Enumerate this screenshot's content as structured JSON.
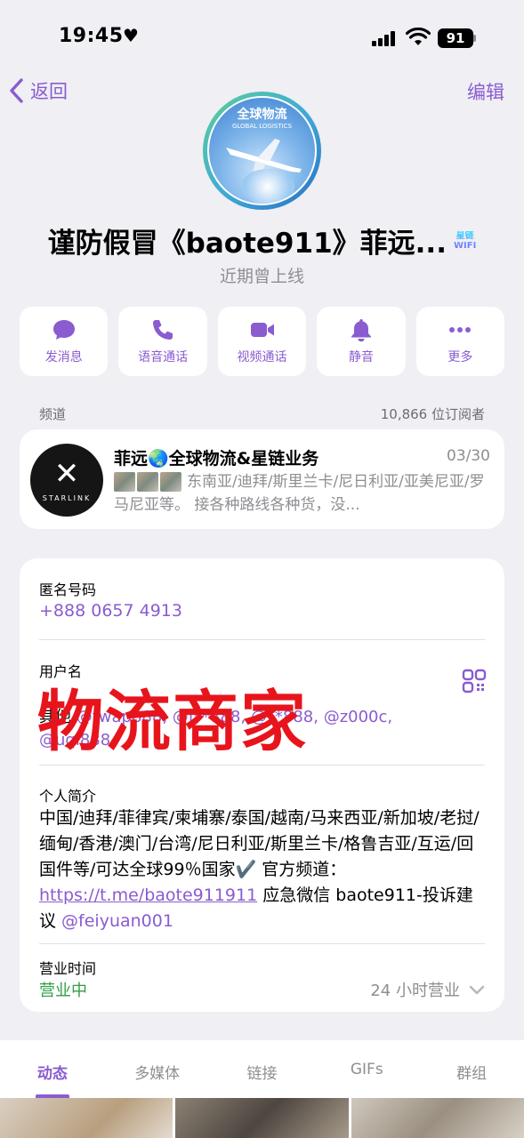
{
  "status_bar": {
    "time": "19:45",
    "battery": "91"
  },
  "nav": {
    "back_label": "返回",
    "edit_label": "编辑"
  },
  "profile": {
    "avatar_text_cn": "全球物流",
    "avatar_text_en": "GLOBAL LOGISTICS",
    "name": "谨防假冒《baote911》菲远...",
    "badge_line1": "星链",
    "badge_line2": "WIFI",
    "last_seen": "近期曾上线"
  },
  "actions": [
    {
      "label": "发消息",
      "icon": "message-icon"
    },
    {
      "label": "语音通话",
      "icon": "phone-icon"
    },
    {
      "label": "视频通话",
      "icon": "video-icon"
    },
    {
      "label": "静音",
      "icon": "bell-icon"
    },
    {
      "label": "更多",
      "icon": "more-icon"
    }
  ],
  "channel": {
    "section_label": "频道",
    "subscribers": "10,866 位订阅者",
    "avatar_text": "STARLINK",
    "name": "菲远🌏全球物流&星链业务",
    "date": "03/30",
    "preview": "东南亚/迪拜/斯里兰卡/尼日利亚/亚美尼亚/罗马尼亚等。 接各种路线各种货，没..."
  },
  "info": {
    "phone_label": "匿名号码",
    "phone_value": "+888 0657 4913",
    "username_label": "用户名",
    "usernames_prefix": "其他",
    "usernames_text": "@twap888, @f**888, @**888, @z000c, @uqi888",
    "watermark": "物流商家",
    "bio_label": "个人简介",
    "bio_text": "中国/迪拜/菲律宾/柬埔寨/泰国/越南/马来西亚/新加坡/老挝/缅甸/香港/澳门/台湾/尼日利亚/斯里兰卡/格鲁吉亚/互运/回国件等/可达全球99％国家✔️ 官方频道：",
    "bio_link": "https://t.me/baote911911",
    "bio_text2": " 应急微信 baote911-投诉建议 ",
    "bio_mention": "@feiyuan001",
    "hours_label": "营业时间",
    "hours_status": "营业中",
    "hours_value": "24 小时营业"
  },
  "tabs": [
    {
      "label": "动态",
      "active": true
    },
    {
      "label": "多媒体",
      "active": false
    },
    {
      "label": "链接",
      "active": false
    },
    {
      "label": "GIFs",
      "active": false
    },
    {
      "label": "群组",
      "active": false
    }
  ],
  "colors": {
    "accent": "#8a5cd0",
    "watermark": "#e8141c",
    "open_status": "#2f9e44"
  }
}
